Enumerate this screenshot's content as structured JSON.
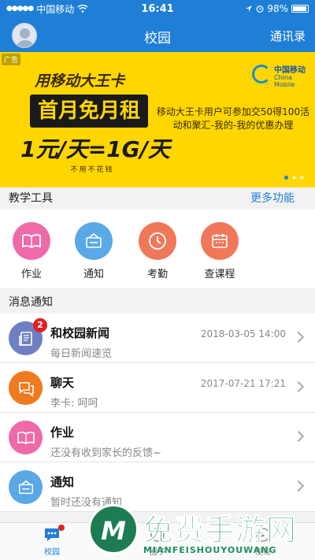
{
  "status": {
    "carrier": "中国移动",
    "time": "16:41",
    "battery": "98%"
  },
  "nav": {
    "title": "校园",
    "right_label": "通讯录"
  },
  "banner": {
    "ad_tag": "广告",
    "card_title": "用移动大王卡",
    "card_highlight": "首月免月租",
    "card_price": "1元/天=1G/天",
    "card_sub": "不用不花钱",
    "brand_zh": "中国移动",
    "brand_en": "China Mobile",
    "description": "移动大王卡用户可参加交50得100活动和聚汇-我的-我的优惠办理"
  },
  "tools_section": {
    "title": "教学工具",
    "more": "更多功能"
  },
  "tools": [
    {
      "label": "作业",
      "color": "#ef6aa8",
      "icon": "book-icon"
    },
    {
      "label": "通知",
      "color": "#5aa9e6",
      "icon": "notice-board-icon"
    },
    {
      "label": "考勤",
      "color": "#f0785a",
      "icon": "clock-icon"
    },
    {
      "label": "查课程",
      "color": "#f0785a",
      "icon": "calendar-icon"
    }
  ],
  "msg_section": {
    "title": "消息通知"
  },
  "messages": [
    {
      "title": "和校园新闻",
      "sub": "每日新闻速览",
      "time": "2018-03-05 14:00",
      "badge": "2",
      "color": "#6e7fc2",
      "icon": "news-icon"
    },
    {
      "title": "聊天",
      "sub": "李卡: 呵呵",
      "time": "2017-07-21 17:21",
      "badge": "",
      "color": "#f07a1e",
      "icon": "chat-icon"
    },
    {
      "title": "作业",
      "sub": "还没有收到家长的反馈~",
      "time": "",
      "badge": "",
      "color": "#ef6aa8",
      "icon": "book-icon"
    },
    {
      "title": "通知",
      "sub": "暂时还没有通知",
      "time": "",
      "badge": "",
      "color": "#5aa9e6",
      "icon": "notice-board-icon"
    }
  ],
  "tabs": [
    {
      "label": "校园",
      "active": true
    },
    {
      "label": "圈子",
      "active": false
    },
    {
      "label": "发现",
      "active": false
    }
  ],
  "watermark": {
    "big": "免费手游网",
    "small": "MIANFEISHOUYOUWANG"
  },
  "colors": {
    "primary": "#1f7fd6",
    "banner": "#ffd600"
  }
}
